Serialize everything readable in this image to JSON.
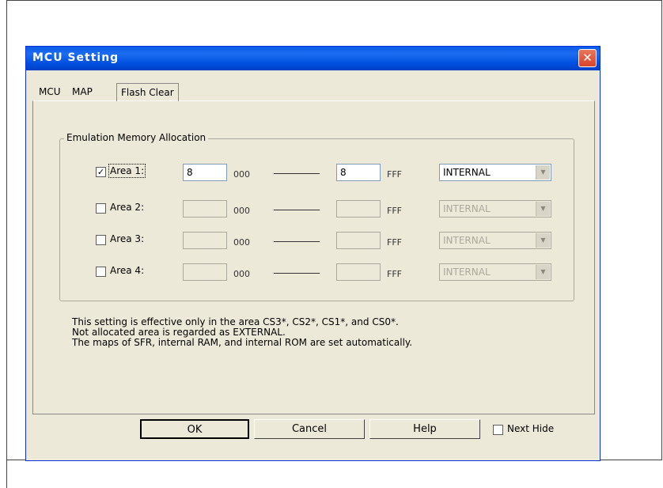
{
  "dialog": {
    "title": "MCU Setting",
    "close_glyph": "✕",
    "tabs": [
      {
        "label": "MCU",
        "selected": false
      },
      {
        "label": "MAP",
        "selected": true
      },
      {
        "label": "Flash Clear",
        "selected": false
      }
    ],
    "group_label": "Emulation Memory Allocation",
    "areas": [
      {
        "label": "Area 1:",
        "checked": true,
        "check_glyph": "✓",
        "from": "8",
        "from_suffix": "000",
        "to": "8",
        "to_suffix": "FFF",
        "type": "INTERNAL",
        "enabled": true
      },
      {
        "label": "Area 2:",
        "checked": false,
        "check_glyph": "",
        "from": "",
        "from_suffix": "000",
        "to": "",
        "to_suffix": "FFF",
        "type": "INTERNAL",
        "enabled": false
      },
      {
        "label": "Area 3:",
        "checked": false,
        "check_glyph": "",
        "from": "",
        "from_suffix": "000",
        "to": "",
        "to_suffix": "FFF",
        "type": "INTERNAL",
        "enabled": false
      },
      {
        "label": "Area 4:",
        "checked": false,
        "check_glyph": "",
        "from": "",
        "from_suffix": "000",
        "to": "",
        "to_suffix": "FFF",
        "type": "INTERNAL",
        "enabled": false
      }
    ],
    "notes": [
      "This setting is effective only in the area CS3*, CS2*, CS1*, and CS0*.",
      "Not allocated area is regarded as EXTERNAL.",
      "The maps of SFR, internal RAM, and internal ROM are set automatically."
    ],
    "buttons": {
      "ok": "OK",
      "cancel": "Cancel",
      "help": "Help"
    },
    "next_hide_label": "Next Hide",
    "dropdown_arrow": "▼"
  }
}
